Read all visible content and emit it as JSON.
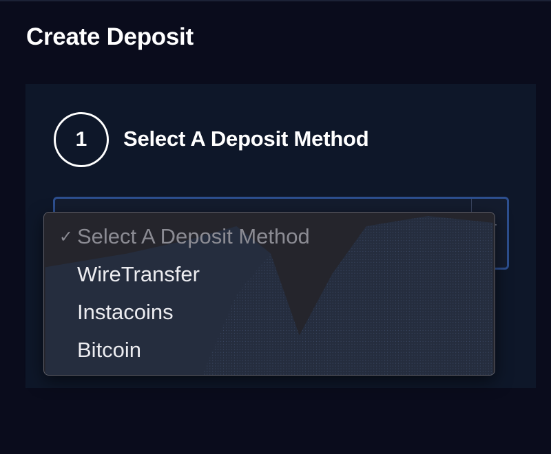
{
  "page": {
    "title": "Create Deposit"
  },
  "step": {
    "number": "1",
    "title": "Select A Deposit Method"
  },
  "select": {
    "selected_label": "Select A Deposit Method",
    "options": [
      {
        "label": "Select A Deposit Method",
        "checked": true,
        "disabled": true
      },
      {
        "label": "WireTransfer",
        "checked": false,
        "disabled": false
      },
      {
        "label": "Instacoins",
        "checked": false,
        "disabled": false
      },
      {
        "label": "Bitcoin",
        "checked": false,
        "disabled": false
      }
    ]
  },
  "icons": {
    "check": "checkmark-icon",
    "select_arrow": "select-arrow-icon"
  },
  "colors": {
    "background": "#0a0c1c",
    "panel": "#0e1729",
    "select_border": "#2d4f8f",
    "dropdown": "#25252c"
  }
}
